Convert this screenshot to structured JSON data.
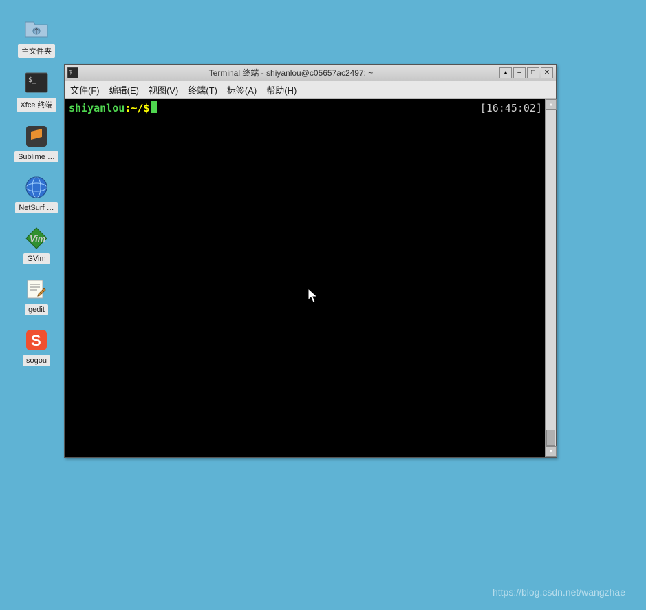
{
  "desktop": {
    "icons": [
      {
        "name": "home-folder",
        "label": "主文件夹",
        "type": "folder"
      },
      {
        "name": "xfce-terminal",
        "label": "Xfce 终端",
        "type": "terminal"
      },
      {
        "name": "sublime",
        "label": "Sublime …",
        "type": "sublime"
      },
      {
        "name": "netsurf",
        "label": "NetSurf …",
        "type": "netsurf"
      },
      {
        "name": "gvim",
        "label": "GVim",
        "type": "gvim"
      },
      {
        "name": "gedit",
        "label": "gedit",
        "type": "gedit"
      },
      {
        "name": "sogou",
        "label": "sogou",
        "type": "sogou"
      }
    ]
  },
  "window": {
    "title": "Terminal 终端 - shiyanlou@c05657ac2497: ~",
    "menu": {
      "file": "文件(F)",
      "edit": "编辑(E)",
      "view": "视图(V)",
      "terminal": "终端(T)",
      "tabs": "标签(A)",
      "help": "帮助(H)"
    }
  },
  "terminal": {
    "prompt_user": "shiyanlou",
    "prompt_sep": ":",
    "prompt_path": "~/",
    "prompt_dollar": " $ ",
    "timestamp": "[16:45:02]"
  },
  "watermark": "https://blog.csdn.net/wangzhae"
}
